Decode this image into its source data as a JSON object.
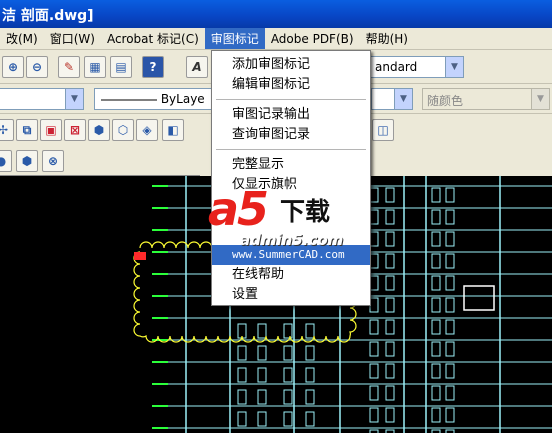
{
  "window": {
    "title": "洁 剖面.dwg]"
  },
  "menubar": {
    "items": [
      {
        "label": "改(M)"
      },
      {
        "label": "窗口(W)"
      },
      {
        "label": "Acrobat 标记(C)"
      },
      {
        "label": "审图标记",
        "active": true
      },
      {
        "label": "Adobe PDF(B)"
      },
      {
        "label": "帮助(H)"
      }
    ]
  },
  "toolbar": {
    "textstyle_value": "andard",
    "linetype_value": "ByLaye",
    "color_value": "随颜色"
  },
  "review_menu": {
    "items": [
      {
        "label": "添加审图标记"
      },
      {
        "label": "编辑审图标记"
      },
      {
        "label": "审图记录输出"
      },
      {
        "label": "查询审图记录"
      },
      {
        "label": "完整显示"
      },
      {
        "label": "仅显示旗帜"
      },
      {
        "label": "www.SummerCAD.com",
        "highlighted": true
      },
      {
        "label": "在线帮助"
      },
      {
        "label": "设置"
      }
    ]
  },
  "watermark": {
    "logo": "a5",
    "download": "下载",
    "site": "admin5.com"
  },
  "colors": {
    "menu_highlight": "#316ac5",
    "cad_cyan": "#9cf0f8",
    "cad_green": "#2bff3a",
    "cad_yellow": "#ffff33",
    "cad_red": "#ff2a2a"
  },
  "icons": [
    "zoom-realtime-icon",
    "zoom-previous-icon",
    "paint-icon",
    "grid-icon",
    "properties-icon",
    "help-icon",
    "text-style-icon",
    "dropdown-arrow-icon"
  ]
}
